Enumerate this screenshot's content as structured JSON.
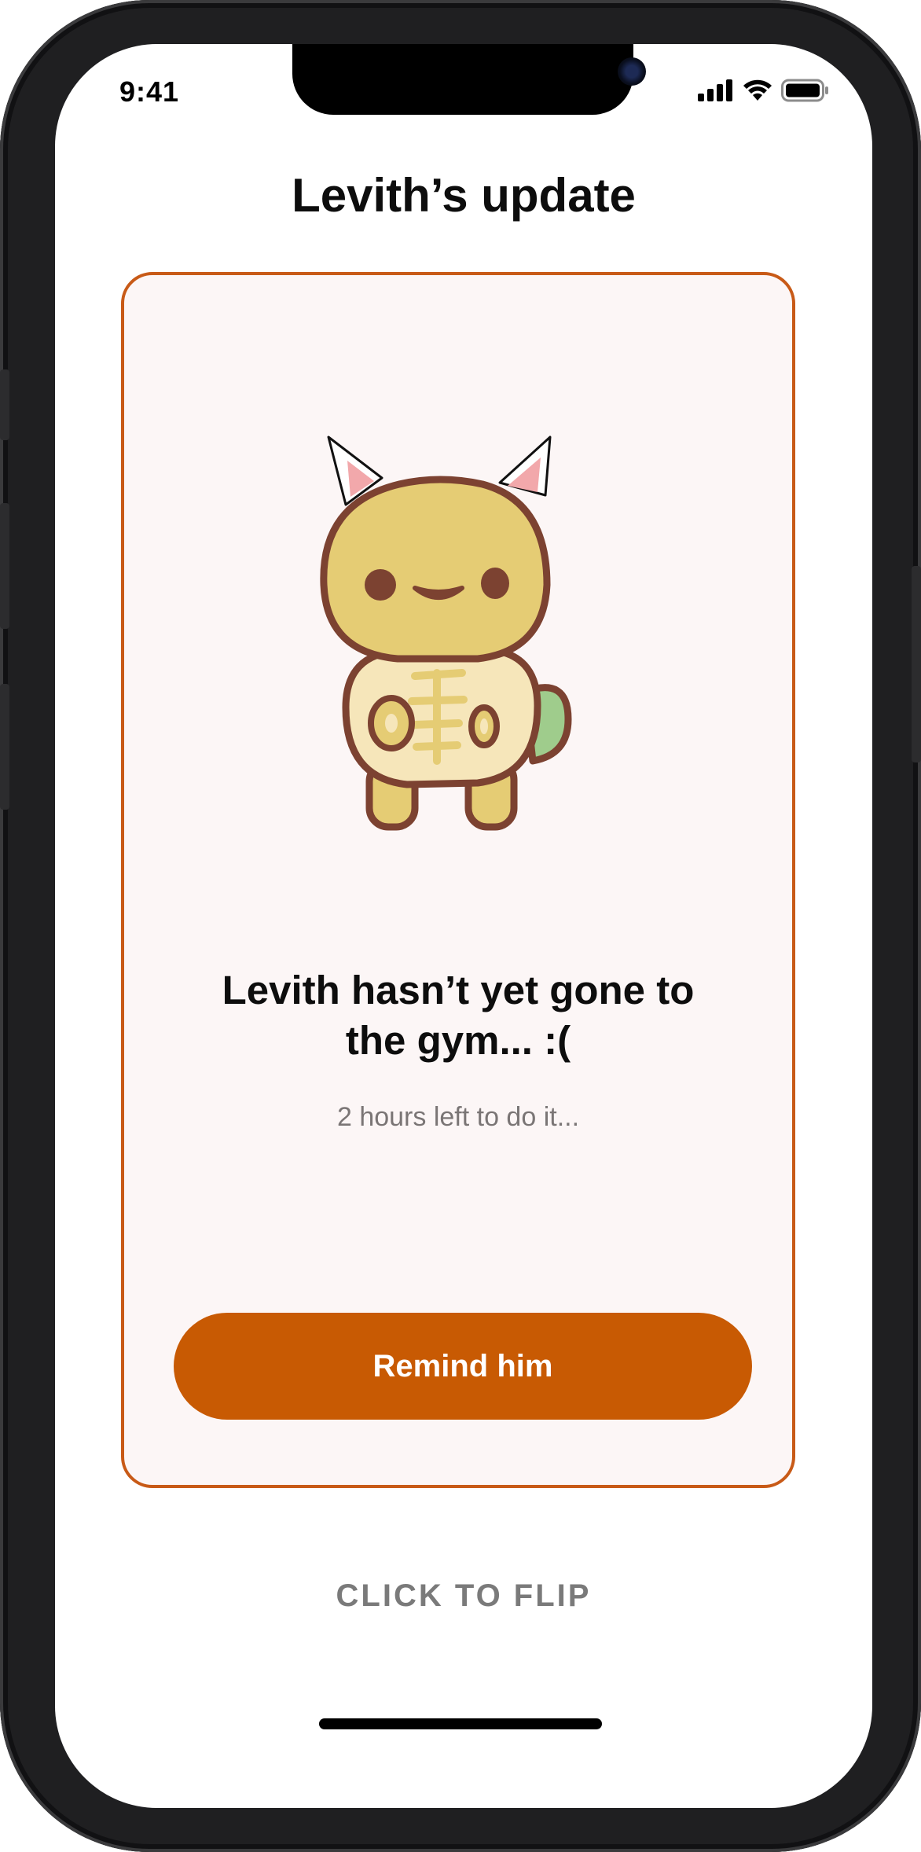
{
  "status_bar": {
    "time": "9:41",
    "icons": [
      "cellular-signal-icon",
      "wifi-icon",
      "battery-icon"
    ]
  },
  "header": {
    "title": "Levith’s update"
  },
  "card": {
    "illustration": "turtle-with-cat-ears-mascot",
    "message_line1": "Levith hasn’t yet gone to",
    "message_line2": "the gym... :(",
    "subtext": "2 hours left to do it...",
    "button_label": "Remind him"
  },
  "footer": {
    "flip_label": "CLICK TO FLIP"
  },
  "colors": {
    "accent": "#c85a03",
    "card_border": "#c85a17",
    "card_background": "#fcf6f6",
    "muted_text": "#7a7575"
  }
}
